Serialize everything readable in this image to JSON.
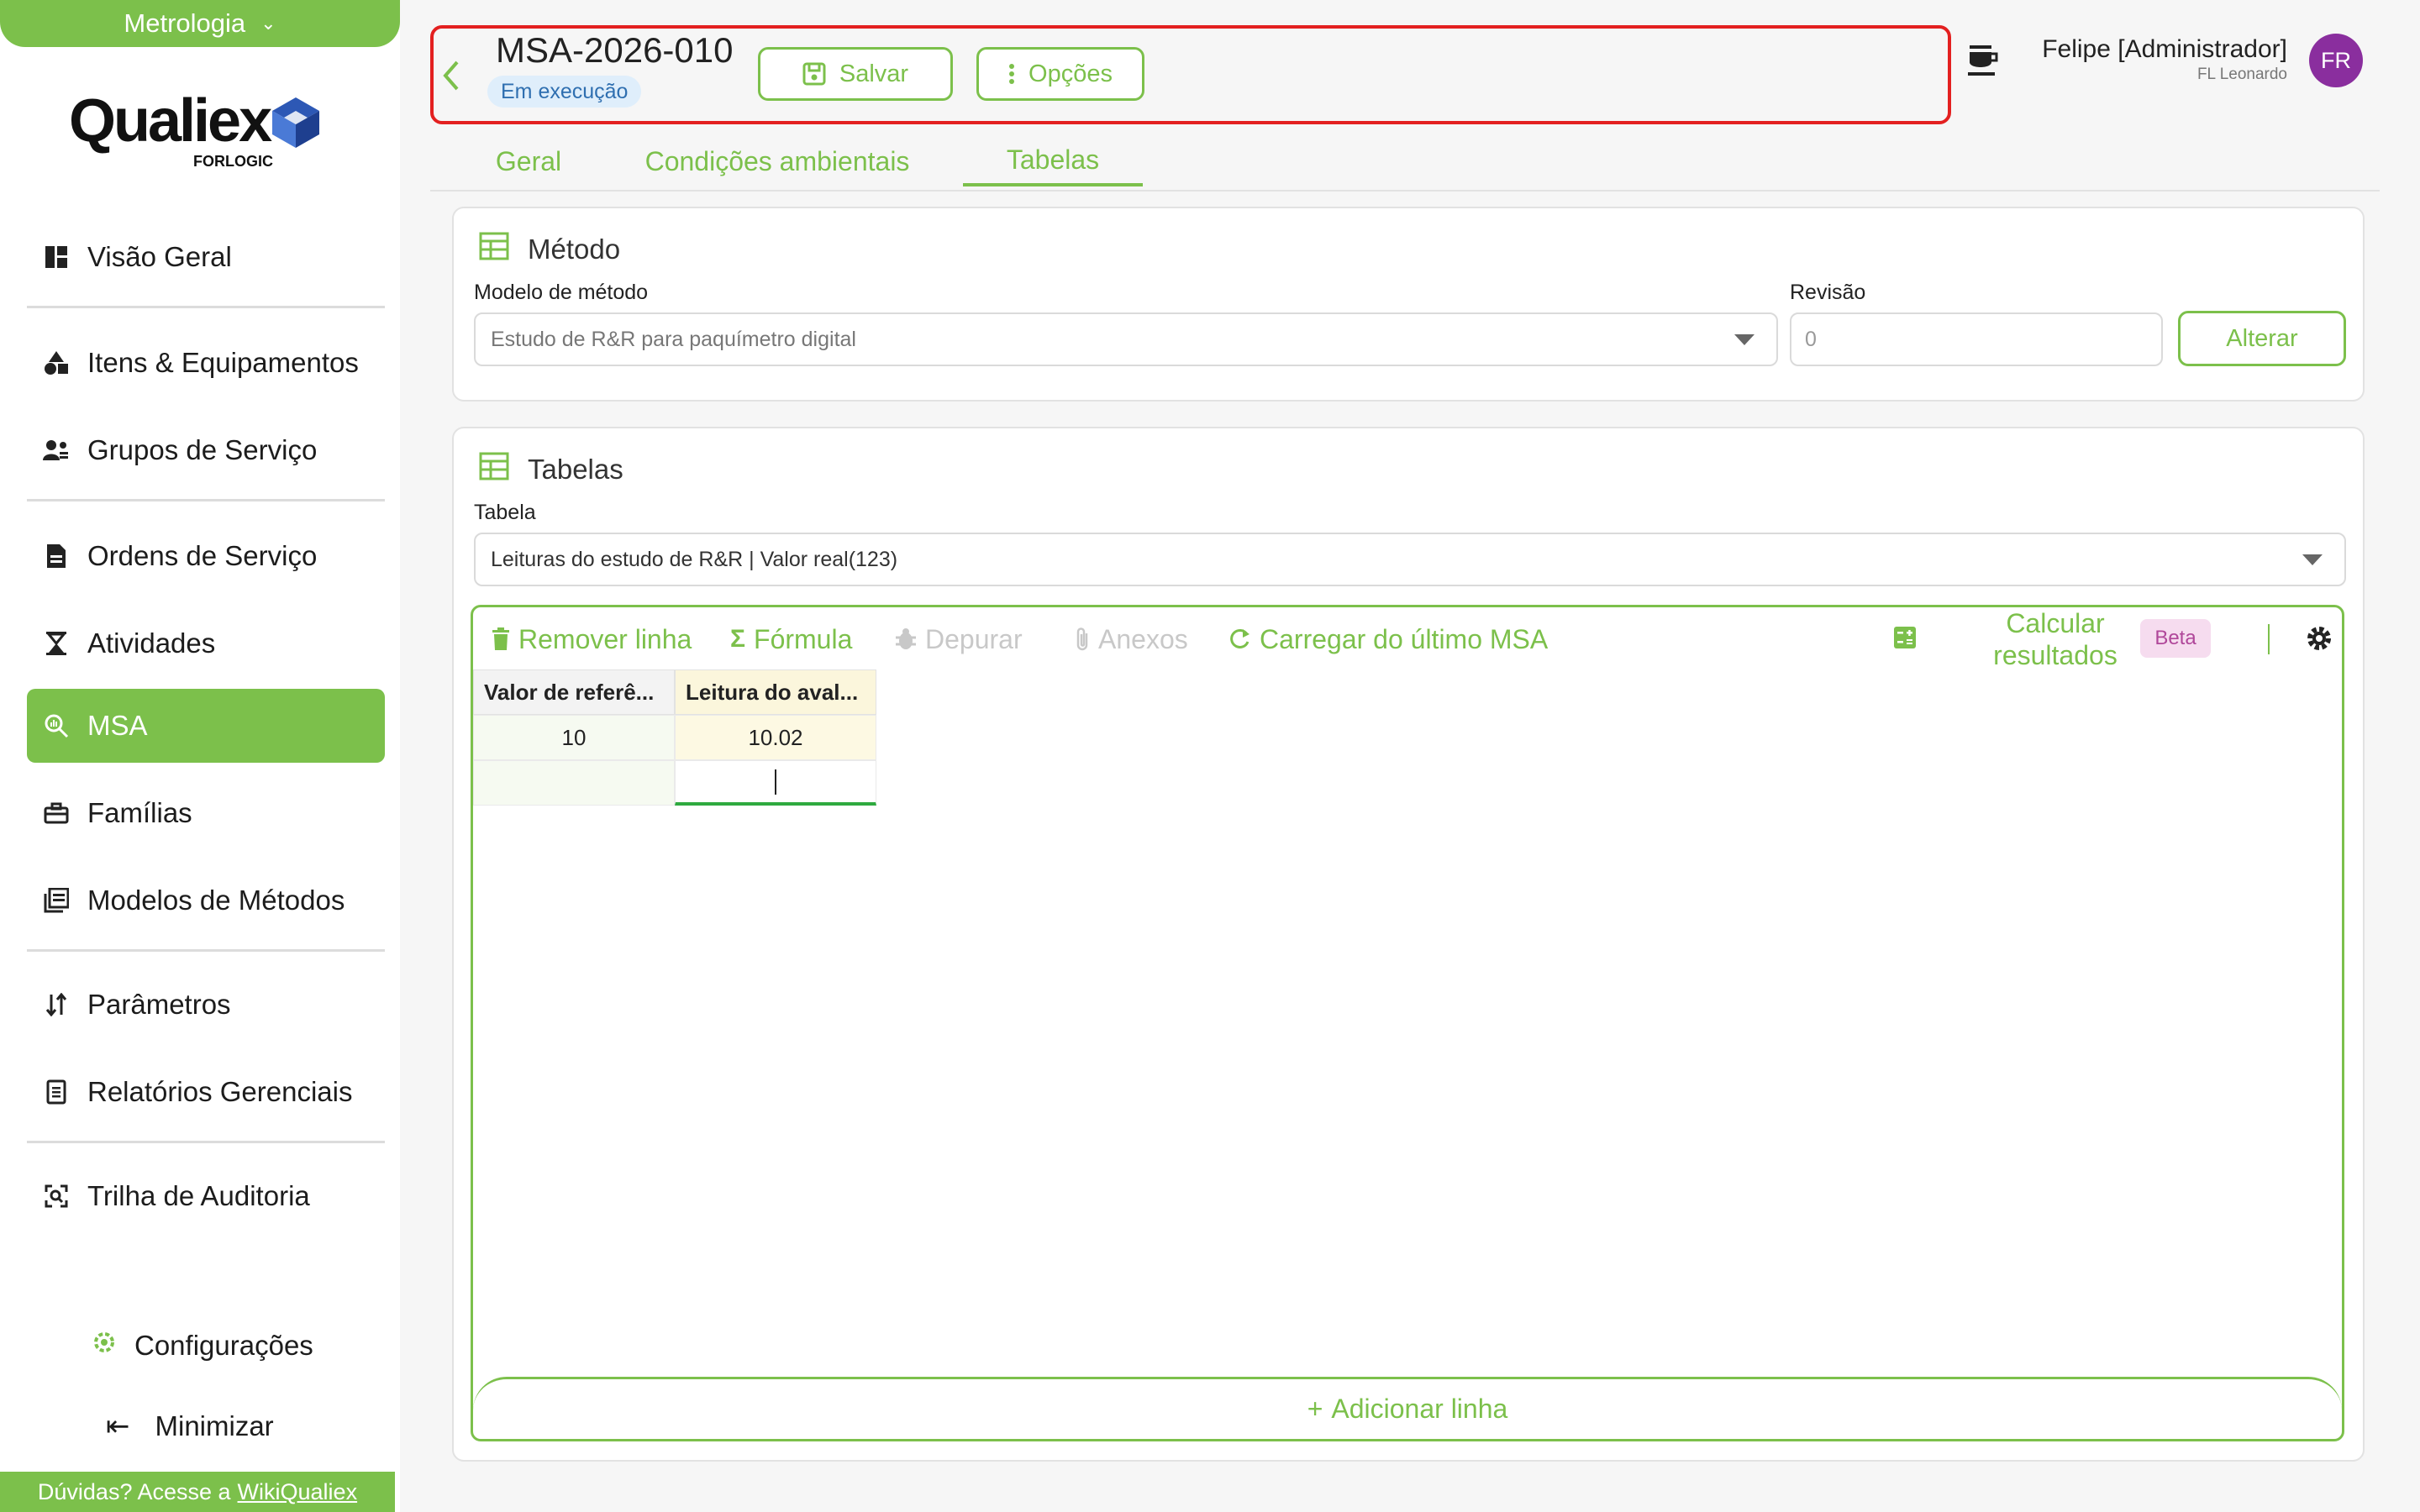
{
  "sidebar": {
    "module": "Metrologia",
    "logo": {
      "word": "Qualiex",
      "sub": "FORLOGIC"
    },
    "items": [
      {
        "label": "Visão Geral",
        "icon": "dashboard-icon"
      },
      {
        "label": "Itens & Equipamentos",
        "icon": "shapes-icon"
      },
      {
        "label": "Grupos de Serviço",
        "icon": "people-group-icon"
      },
      {
        "label": "Ordens de Serviço",
        "icon": "document-icon"
      },
      {
        "label": "Atividades",
        "icon": "hourglass-icon"
      },
      {
        "label": "MSA",
        "icon": "magnifier-chart-icon"
      },
      {
        "label": "Famílias",
        "icon": "briefcase-icon"
      },
      {
        "label": "Modelos de Métodos",
        "icon": "library-icon"
      },
      {
        "label": "Parâmetros",
        "icon": "sort-icon"
      },
      {
        "label": "Relatórios Gerenciais",
        "icon": "report-icon"
      },
      {
        "label": "Trilha de Auditoria",
        "icon": "audit-scan-icon"
      }
    ],
    "active": "MSA",
    "config_label": "Configurações",
    "minimize_label": "Minimizar",
    "help_text": "Dúvidas? Acesse a",
    "help_link": "WikiQualiex"
  },
  "header": {
    "title": "MSA-2026-010",
    "status": "Em execução",
    "save_label": "Salvar",
    "options_label": "Opções",
    "user_name": "Felipe [Administrador]",
    "user_org": "FL Leonardo",
    "avatar_initials": "FR"
  },
  "tabs": [
    {
      "label": "Geral",
      "active": false
    },
    {
      "label": "Condições ambientais",
      "active": false
    },
    {
      "label": "Tabelas",
      "active": true
    }
  ],
  "method_card": {
    "title": "Método",
    "model_label": "Modelo de método",
    "model_value": "Estudo de R&R para paquímetro digital",
    "revision_label": "Revisão",
    "revision_value": "0",
    "change_label": "Alterar"
  },
  "tables_card": {
    "title": "Tabelas",
    "table_label": "Tabela",
    "table_value": "Leituras do estudo de R&R | Valor real(123)",
    "toolbar": {
      "remove_row": "Remover linha",
      "formula": "Fórmula",
      "debug": "Depurar",
      "attachments": "Anexos",
      "load_last": "Carregar do último MSA",
      "calc_line1": "Calcular",
      "calc_line2": "resultados",
      "beta": "Beta"
    },
    "columns": [
      "Valor de referê...",
      "Leitura do aval..."
    ],
    "rows": [
      [
        "10",
        "10.02"
      ],
      [
        "",
        ""
      ]
    ],
    "add_row": "Adicionar linha"
  },
  "colors": {
    "accent": "#7cc04b",
    "highlight": "#e32020",
    "status_bg": "#dfeefb",
    "avatar": "#8a2e9e"
  }
}
